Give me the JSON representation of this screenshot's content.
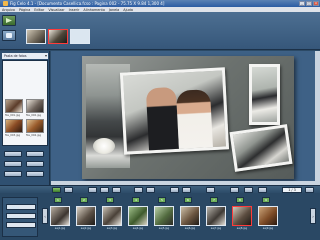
{
  "titlebar": {
    "text": "Fig Celo 4.1 - [Documento Casellica.fcso : Pagina 002 - 75.75 X 9.84 1,300 4]"
  },
  "menubar": {
    "items": [
      "Arquivo",
      "Página",
      "Editar",
      "Visualizar",
      "Inserir",
      "Alinhamento",
      "Janela",
      "Ajuda"
    ]
  },
  "left_panel": {
    "dropdown_label": "Pasta de fotos",
    "captions": [
      "file_001.jpg",
      "file_002.jpg",
      "file_003.jpg",
      "file_004.jpg"
    ]
  },
  "bottom_bar": {
    "zoom": "1 / 3"
  },
  "filmstrip": {
    "numbers": [
      "1",
      "2",
      "3",
      "4",
      "5",
      "6",
      "7",
      "8",
      "9"
    ],
    "captions": [
      "aaj1.jpg",
      "aaj2.jpg",
      "aaj3.jpg",
      "aaj4.jpg",
      "aaj5.jpg",
      "aaj6.jpg",
      "aaj7.jpg",
      "aaj8.jpg",
      "aaj9.jpg"
    ],
    "side_labels": [
      "Folder",
      "Photos"
    ]
  }
}
